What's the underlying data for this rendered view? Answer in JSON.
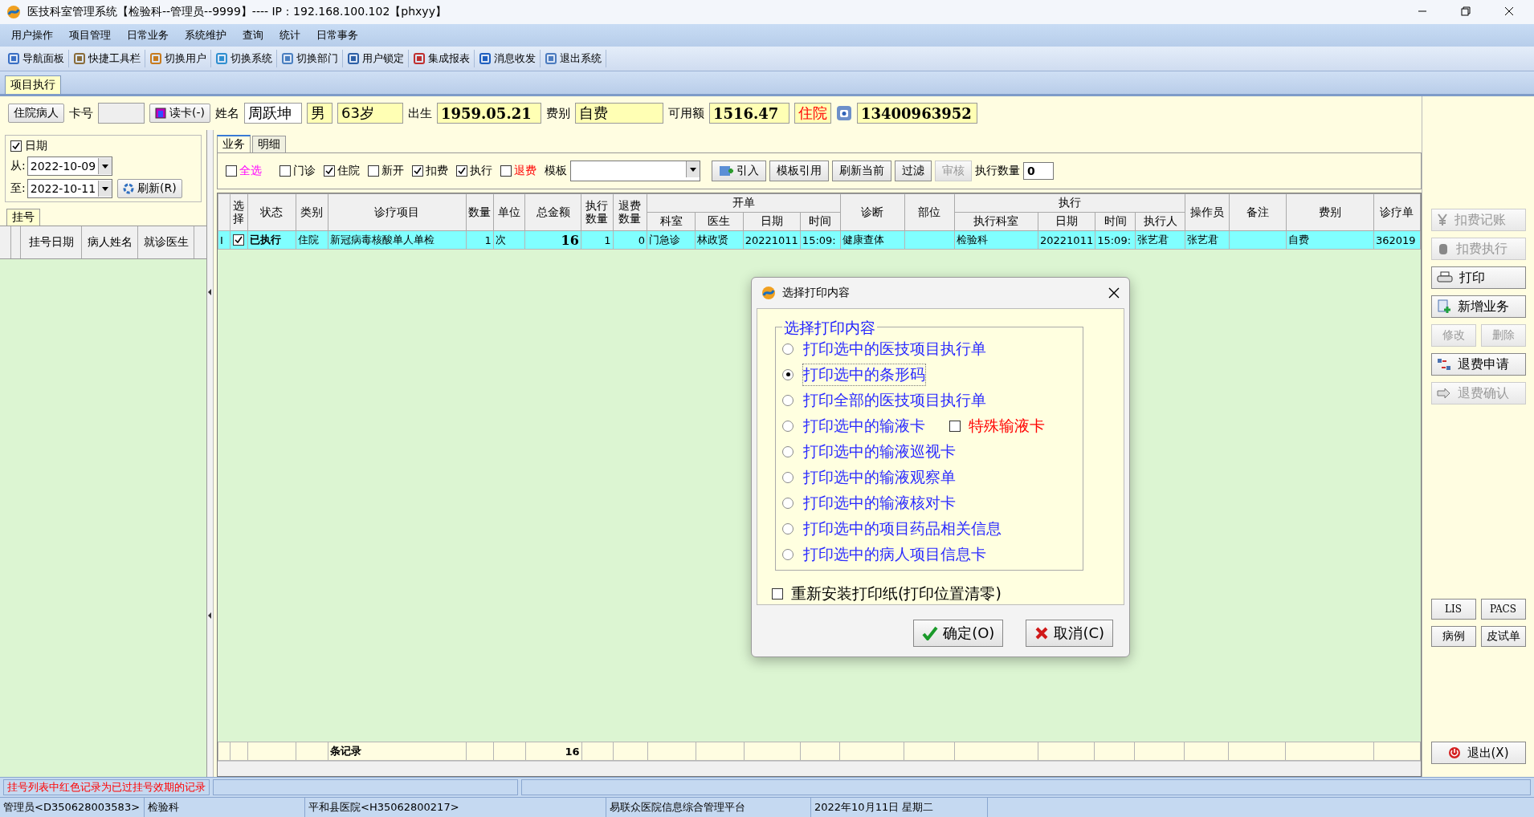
{
  "window": {
    "title": "医技科室管理系统【检验科--管理员--9999】---- IP：192.168.100.102【phxyy】"
  },
  "menu": [
    "用户操作",
    "项目管理",
    "日常业务",
    "系统维护",
    "查询",
    "统计",
    "日常事务"
  ],
  "toolbar": [
    "导航面板",
    "快捷工具栏",
    "切换用户",
    "切换系统",
    "切换部门",
    "用户锁定",
    "集成报表",
    "消息收发",
    "退出系统"
  ],
  "page_tab": "项目执行",
  "patient": {
    "type_button": "住院病人",
    "card_label": "卡号",
    "read_card": "读卡(-)",
    "name_label": "姓名",
    "name": "周跃坤",
    "sex": "男",
    "age": "63岁",
    "birth_label": "出生",
    "birth": "1959.05.21",
    "fee_label": "费别",
    "fee": "自费",
    "balance_label": "可用额",
    "balance": "1516.47",
    "status": "住院",
    "phone": "13400963952"
  },
  "date_filter": {
    "label": "日期",
    "checked": true,
    "from_label": "从:",
    "from": "2022-10-09",
    "to_label": "至:",
    "to": "2022-10-11",
    "refresh": "刷新(R)"
  },
  "registration": {
    "tab": "挂号",
    "columns": [
      "挂号日期",
      "病人姓名",
      "就诊医生"
    ]
  },
  "center_tabs": [
    {
      "label": "业务",
      "selected": true
    },
    {
      "label": "明细",
      "selected": false
    }
  ],
  "filters": [
    {
      "label": "全选",
      "checked": false,
      "kind": "all"
    },
    {
      "label": "门诊",
      "checked": false,
      "kind": "plain"
    },
    {
      "label": "住院",
      "checked": true,
      "kind": "plain"
    },
    {
      "label": "新开",
      "checked": false,
      "kind": "plain"
    },
    {
      "label": "扣费",
      "checked": true,
      "kind": "plain"
    },
    {
      "label": "执行",
      "checked": true,
      "kind": "plain"
    },
    {
      "label": "退费",
      "checked": false,
      "kind": "refund"
    }
  ],
  "template_label": "模板",
  "actions": [
    {
      "label": "引入",
      "disabled": false
    },
    {
      "label": "模板引用",
      "disabled": false
    },
    {
      "label": "刷新当前",
      "disabled": false
    },
    {
      "label": "过滤",
      "disabled": false
    },
    {
      "label": "审核",
      "disabled": true
    }
  ],
  "exec_count_label": "执行数量",
  "exec_count": "0",
  "table": {
    "columns": [
      {
        "label": "选择"
      },
      {
        "label": "状态"
      },
      {
        "label": "类别"
      },
      {
        "label": "诊疗项目"
      },
      {
        "label": "数量"
      },
      {
        "label": "单位"
      },
      {
        "label": "总金额"
      },
      {
        "label": "执行数量"
      },
      {
        "label": "退费数量"
      },
      {
        "group": "开单",
        "colspan": 4,
        "children": [
          "科室",
          "医生",
          "日期",
          "时间"
        ]
      },
      {
        "label": "诊断"
      },
      {
        "label": "部位"
      },
      {
        "group": "执行",
        "colspan": 4,
        "children": [
          "执行科室",
          "日期",
          "时间",
          "执行人"
        ]
      },
      {
        "label": "操作员"
      },
      {
        "label": "备注"
      },
      {
        "label": "费别"
      },
      {
        "label": "诊疗单"
      }
    ],
    "rows": [
      {
        "marker": "I",
        "checked": true,
        "cells": [
          null,
          "已执行",
          "住院",
          "新冠病毒核酸单人单检",
          "1",
          "次",
          "16",
          "1",
          "0",
          "门急诊",
          "林政贤",
          "20221011",
          "15:09:",
          "健康查体",
          null,
          "检验科",
          "20221011",
          "15:09:",
          "张艺君",
          "张艺君",
          null,
          "自费",
          "362019"
        ]
      }
    ],
    "footer": {
      "label": "条记录",
      "total": "16"
    }
  },
  "side_buttons": [
    {
      "label": "扣费记账",
      "disabled": true,
      "kind": "wide"
    },
    {
      "label": "扣费执行",
      "disabled": true,
      "kind": "wide"
    },
    {
      "label": "打印",
      "disabled": false,
      "kind": "wide"
    },
    {
      "label": "新增业务",
      "disabled": false,
      "kind": "wide"
    },
    {
      "label": "修改",
      "disabled": true,
      "kind": "half"
    },
    {
      "label": "删除",
      "disabled": true,
      "kind": "half"
    },
    {
      "label": "退费申请",
      "disabled": false,
      "kind": "wide"
    },
    {
      "label": "退费确认",
      "disabled": true,
      "kind": "wide"
    }
  ],
  "side_small": [
    "LIS",
    "PACS",
    "病例",
    "皮试单"
  ],
  "exit_button": "退出(X)",
  "status_message": "挂号列表中红色记录为已过挂号效期的记录",
  "status_bar": [
    "管理员<D350628003583>",
    "检验科",
    "平和县医院<H35062800217>",
    "易联众医院信息综合管理平台",
    "2022年10月11日 星期二"
  ],
  "dialog": {
    "title": "选择打印内容",
    "group_title": "选择打印内容",
    "options": [
      {
        "label": "打印选中的医技项目执行单",
        "selected": false
      },
      {
        "label": "打印选中的条形码",
        "selected": true
      },
      {
        "label": "打印全部的医技项目执行单",
        "selected": false
      },
      {
        "label": "打印选中的输液卡",
        "selected": false
      },
      {
        "label": "打印选中的输液巡视卡",
        "selected": false
      },
      {
        "label": "打印选中的输液观察单",
        "selected": false
      },
      {
        "label": "打印选中的输液核对卡",
        "selected": false
      },
      {
        "label": "打印选中的项目药品相关信息",
        "selected": false
      },
      {
        "label": "打印选中的病人项目信息卡",
        "selected": false
      }
    ],
    "special": {
      "label": "特殊输液卡",
      "checked": false
    },
    "reinstall": {
      "label": "重新安装打印纸(打印位置清零)",
      "checked": false
    },
    "ok": "确定(O)",
    "cancel": "取消(C)"
  }
}
